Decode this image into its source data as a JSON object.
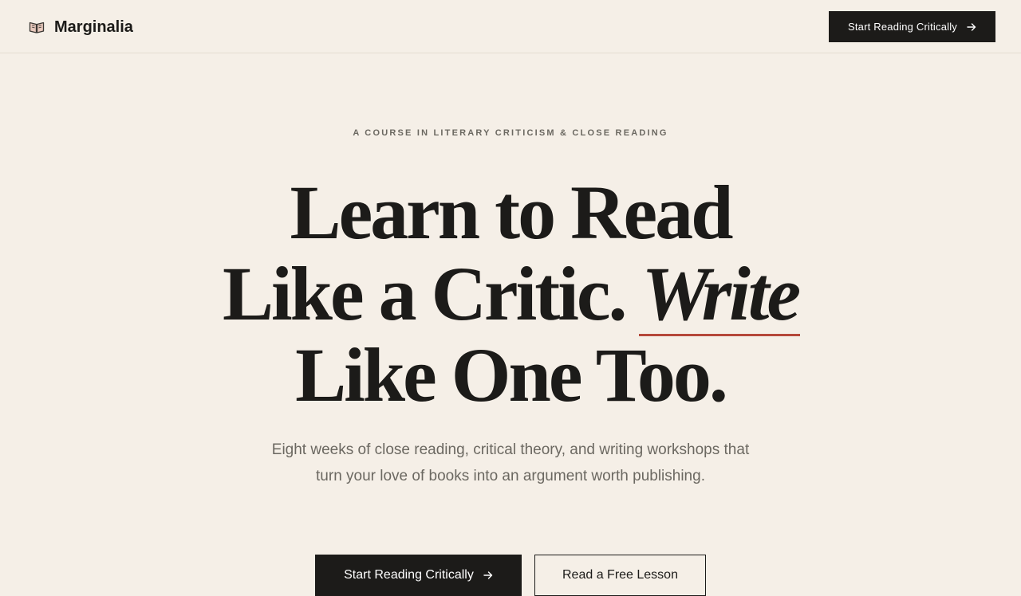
{
  "header": {
    "brand_name": "Marginalia",
    "brand_icon": "open-book-icon",
    "cta_label": "Start Reading Critically",
    "cta_icon": "arrow-right-icon"
  },
  "hero": {
    "eyebrow": "A COURSE IN LITERARY CRITICISM & CLOSE READING",
    "headline_line1": "Learn to Read",
    "headline_line2_start": "Like a Critic.",
    "headline_accent": "Write",
    "headline_line3": "Like One Too.",
    "subhead": "Eight weeks of close reading, critical theory, and writing workshops that turn your love of books into an argument worth publishing.",
    "primary_cta_label": "Start Reading Critically",
    "secondary_cta_label": "Read a Free Lesson"
  },
  "colors": {
    "background": "#f5efe7",
    "ink": "#1c1b19",
    "muted": "#6b6861",
    "accent": "#b5483a",
    "divider": "#e4ddd2"
  }
}
